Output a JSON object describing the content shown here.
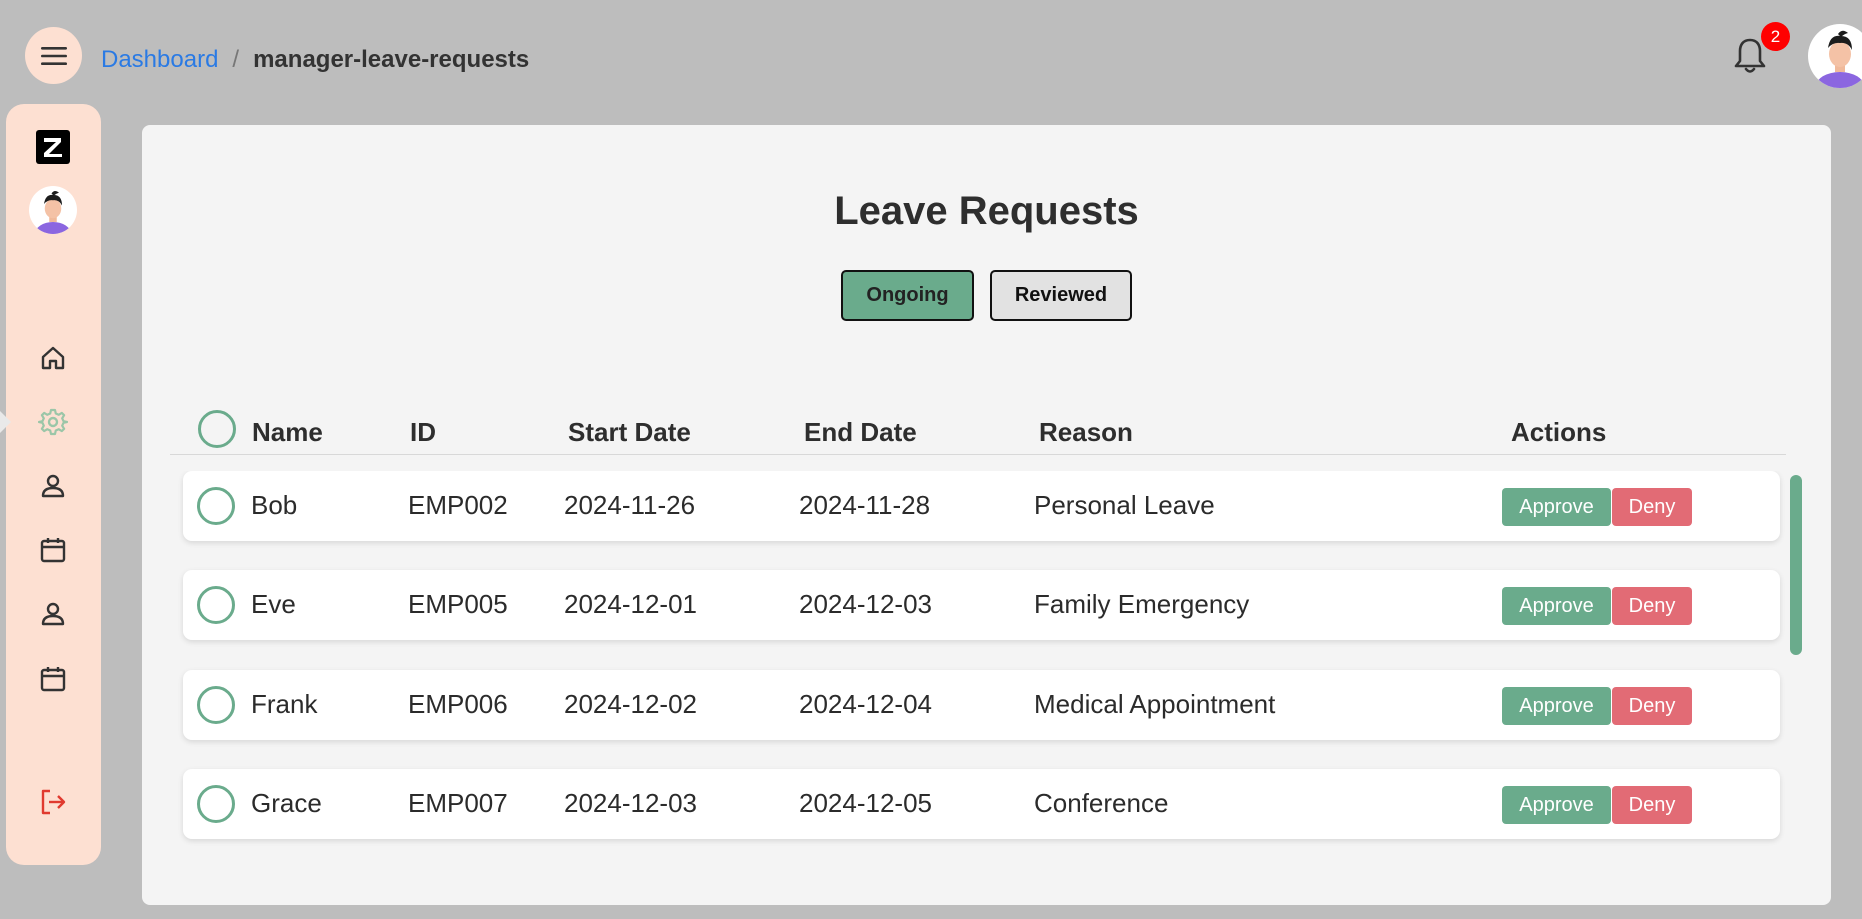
{
  "breadcrumb": {
    "root": "Dashboard",
    "separator": "/",
    "current": "manager-leave-requests"
  },
  "header": {
    "notification_count": "2",
    "menu_icon": "hamburger-icon",
    "bell_icon": "bell-icon"
  },
  "sidebar": {
    "items": [
      {
        "name": "home",
        "icon": "home-icon"
      },
      {
        "name": "settings",
        "icon": "gear-icon",
        "active": true
      },
      {
        "name": "profile",
        "icon": "user-icon"
      },
      {
        "name": "calendar",
        "icon": "calendar-icon"
      },
      {
        "name": "profile-2",
        "icon": "user-icon"
      },
      {
        "name": "calendar-2",
        "icon": "calendar-icon"
      }
    ],
    "logout_icon": "logout-icon"
  },
  "page": {
    "title": "Leave Requests",
    "tabs": [
      "Ongoing",
      "Reviewed"
    ]
  },
  "table": {
    "columns": [
      "Name",
      "ID",
      "Start Date",
      "End Date",
      "Reason",
      "Actions"
    ],
    "rows": [
      {
        "name": "Bob",
        "id": "EMP002",
        "start": "2024-11-26",
        "end": "2024-11-28",
        "reason": "Personal Leave"
      },
      {
        "name": "Eve",
        "id": "EMP005",
        "start": "2024-12-01",
        "end": "2024-12-03",
        "reason": "Family Emergency"
      },
      {
        "name": "Frank",
        "id": "EMP006",
        "start": "2024-12-02",
        "end": "2024-12-04",
        "reason": "Medical Appointment"
      },
      {
        "name": "Grace",
        "id": "EMP007",
        "start": "2024-12-03",
        "end": "2024-12-05",
        "reason": "Conference"
      }
    ],
    "approve_label": "Approve",
    "deny_label": "Deny"
  },
  "colors": {
    "accent": "#6aab8c",
    "deny": "#e26b75",
    "sidebar": "#fde0d2",
    "link": "#2a7ae4",
    "logout": "#e03a2f"
  }
}
